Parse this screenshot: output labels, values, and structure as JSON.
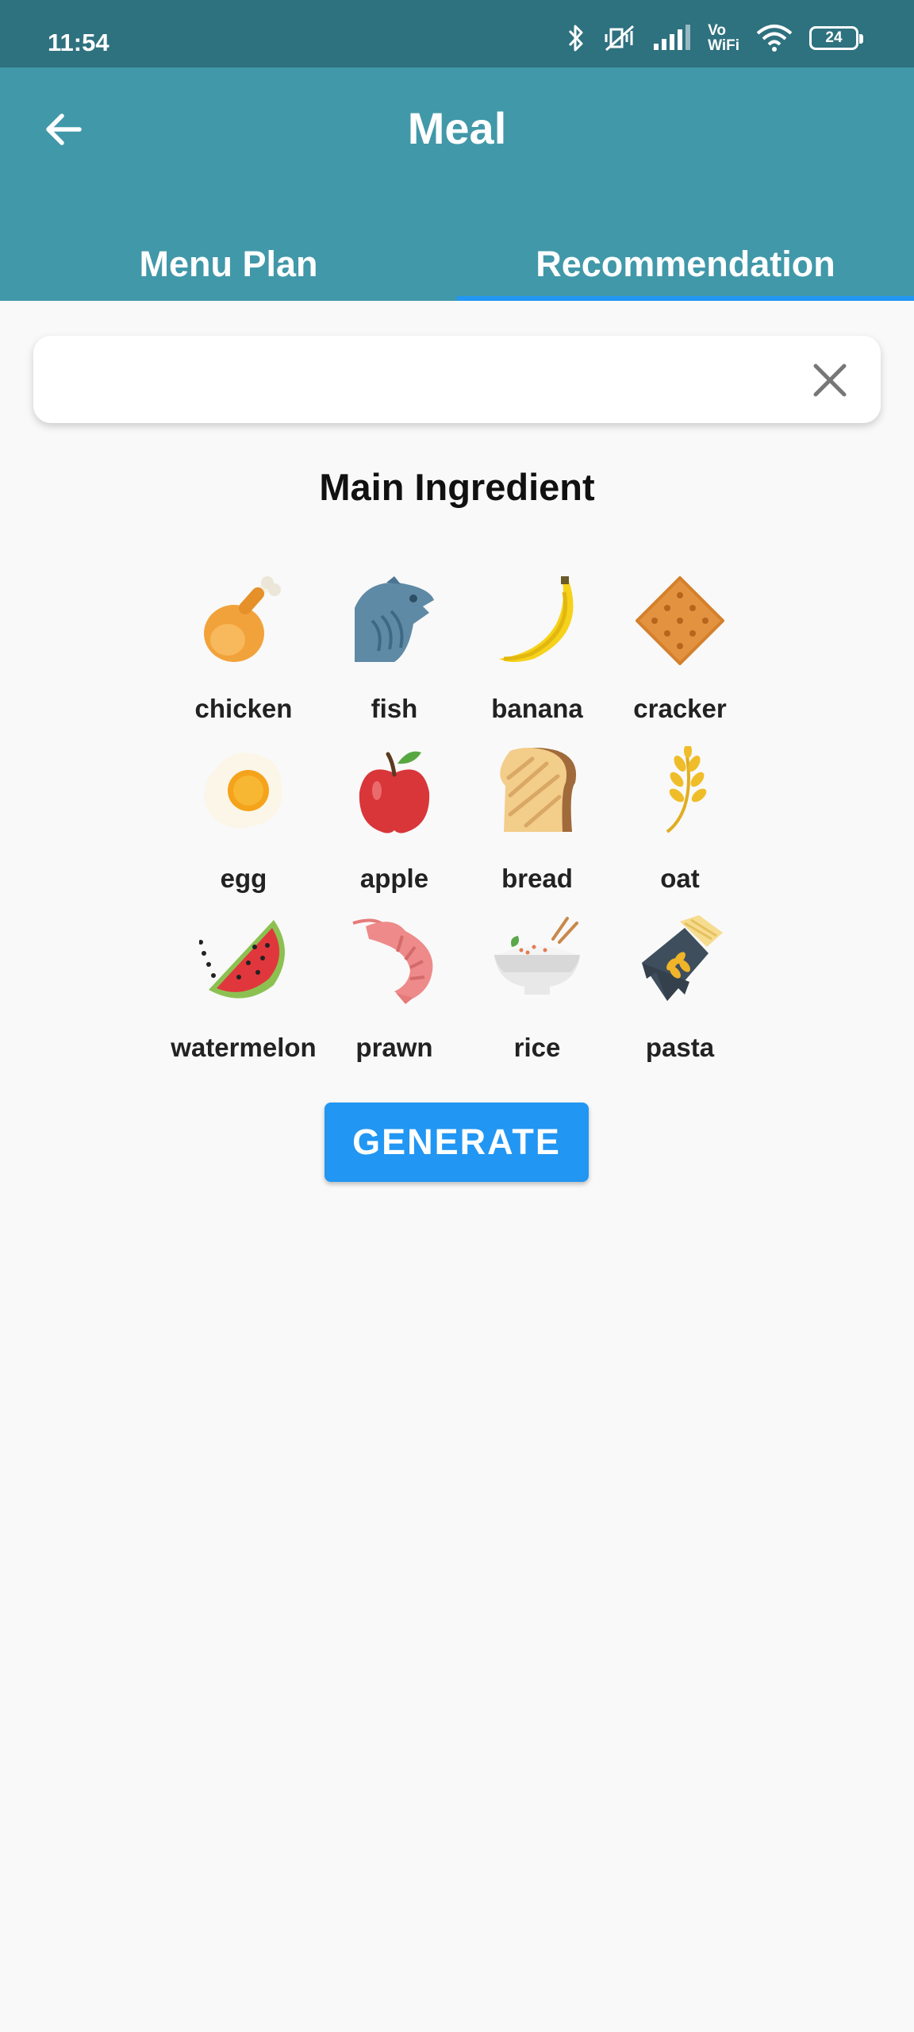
{
  "status_bar": {
    "time": "11:54",
    "battery": "24",
    "icons": [
      "bluetooth-icon",
      "mute-icon",
      "signal-icon",
      "vowifi-icon",
      "wifi-icon",
      "battery-icon"
    ],
    "vowifi_top": "Vo",
    "vowifi_bottom": "WiFi"
  },
  "app_bar": {
    "title": "Meal",
    "back_icon": "arrow-left-icon",
    "tabs": [
      {
        "label": "Menu Plan",
        "selected": false
      },
      {
        "label": "Recommendation",
        "selected": true
      }
    ],
    "indicator_color": "#2196f3",
    "background_color": "#4198a9"
  },
  "search": {
    "value": "",
    "placeholder": "",
    "clear_icon": "close-icon"
  },
  "section_title": "Main Ingredient",
  "ingredients": [
    {
      "label": "chicken",
      "icon": "chicken-icon"
    },
    {
      "label": "fish",
      "icon": "fish-icon"
    },
    {
      "label": "banana",
      "icon": "banana-icon"
    },
    {
      "label": "cracker",
      "icon": "cracker-icon"
    },
    {
      "label": "egg",
      "icon": "egg-icon"
    },
    {
      "label": "apple",
      "icon": "apple-icon"
    },
    {
      "label": "bread",
      "icon": "bread-icon"
    },
    {
      "label": "oat",
      "icon": "oat-icon"
    },
    {
      "label": "watermelon",
      "icon": "watermelon-icon"
    },
    {
      "label": "prawn",
      "icon": "prawn-icon"
    },
    {
      "label": "rice",
      "icon": "rice-icon"
    },
    {
      "label": "pasta",
      "icon": "pasta-icon"
    }
  ],
  "generate_button": {
    "label": "GENERATE",
    "color": "#2196f3"
  }
}
